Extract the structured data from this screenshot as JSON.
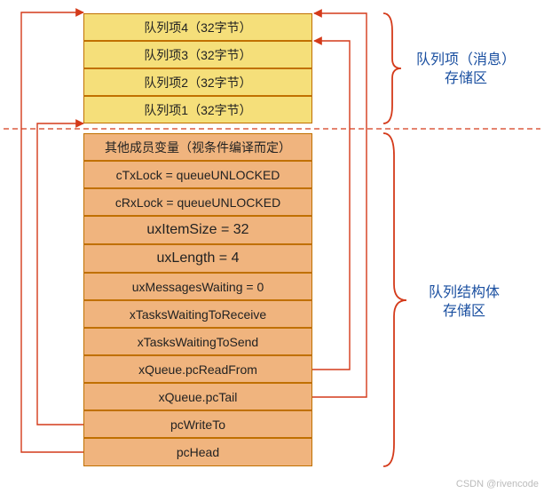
{
  "queue_items_label": "队列项（消息）\n存储区",
  "queue_struct_label": "队列结构体\n存储区",
  "items": [
    "队列项4（32字节）",
    "队列项3（32字节）",
    "队列项2（32字节）",
    "队列项1（32字节）"
  ],
  "members": [
    "其他成员变量（视条件编译而定）",
    "cTxLock = queueUNLOCKED",
    "cRxLock = queueUNLOCKED",
    "uxItemSize = 32",
    "uxLength = 4",
    "uxMessagesWaiting = 0",
    "xTasksWaitingToReceive",
    "xTasksWaitingToSend",
    "xQueue.pcReadFrom",
    "xQueue.pcTail",
    "pcWriteTo",
    "pcHead"
  ],
  "watermark": "CSDN @rivencode"
}
